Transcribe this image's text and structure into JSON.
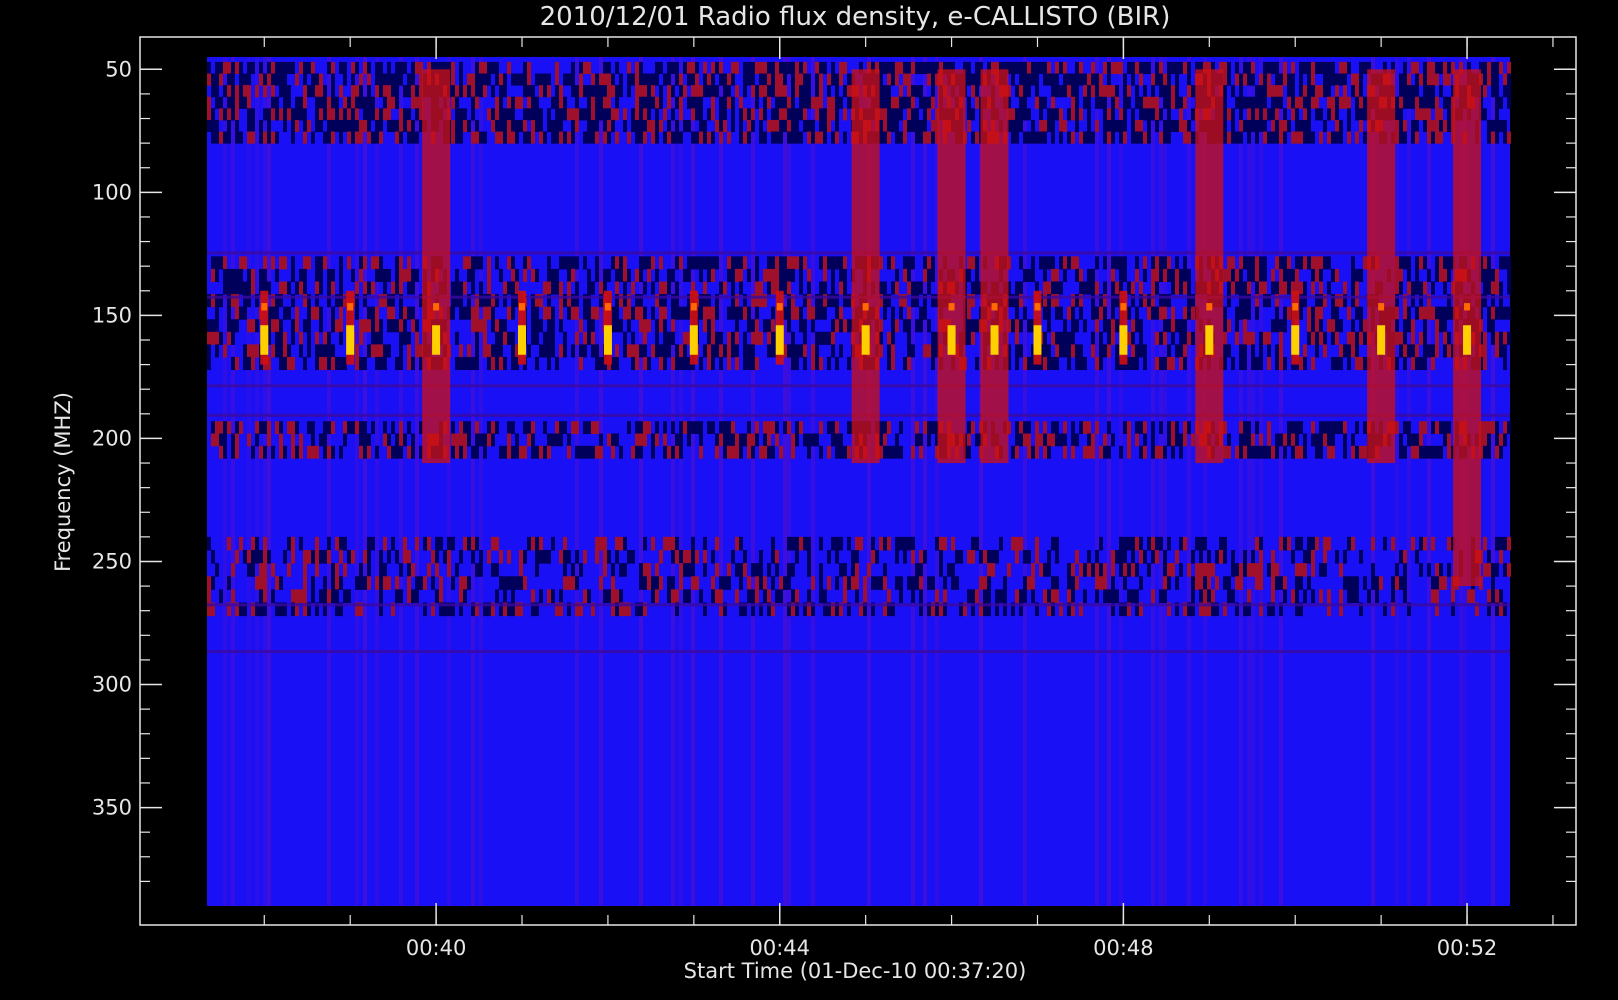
{
  "chart_data": {
    "type": "heatmap",
    "title": "2010/12/01  Radio flux density, e-CALLISTO (BIR)",
    "xlabel": "Start Time (01-Dec-10 00:37:20)",
    "ylabel": "Frequency (MHZ)",
    "y_axis_inverted": true,
    "ylim": [
      45,
      390
    ],
    "xlim": [
      "00:37:20",
      "00:52:30"
    ],
    "x_ticks": [
      "00:40",
      "00:44",
      "00:48",
      "00:52"
    ],
    "y_ticks": [
      50,
      100,
      150,
      200,
      250,
      300,
      350
    ],
    "colormap": [
      "#000000",
      "#0000ff",
      "#cc0000",
      "#ffff00"
    ],
    "background_color": "#000000",
    "bursts": [
      {
        "time": "00:38:00",
        "freq_range": [
          140,
          170
        ],
        "intensity": "high"
      },
      {
        "time": "00:39:00",
        "freq_range": [
          140,
          170
        ],
        "intensity": "high"
      },
      {
        "time": "00:40:00",
        "freq_range": [
          50,
          210
        ],
        "intensity": "high"
      },
      {
        "time": "00:41:00",
        "freq_range": [
          140,
          170
        ],
        "intensity": "high"
      },
      {
        "time": "00:42:00",
        "freq_range": [
          140,
          170
        ],
        "intensity": "high"
      },
      {
        "time": "00:43:00",
        "freq_range": [
          140,
          170
        ],
        "intensity": "high"
      },
      {
        "time": "00:44:00",
        "freq_range": [
          140,
          170
        ],
        "intensity": "high"
      },
      {
        "time": "00:45:00",
        "freq_range": [
          50,
          210
        ],
        "intensity": "high"
      },
      {
        "time": "00:46:00",
        "freq_range": [
          50,
          210
        ],
        "intensity": "high"
      },
      {
        "time": "00:46:30",
        "freq_range": [
          50,
          210
        ],
        "intensity": "high"
      },
      {
        "time": "00:47:00",
        "freq_range": [
          140,
          170
        ],
        "intensity": "high"
      },
      {
        "time": "00:48:00",
        "freq_range": [
          140,
          170
        ],
        "intensity": "high"
      },
      {
        "time": "00:49:00",
        "freq_range": [
          50,
          210
        ],
        "intensity": "high"
      },
      {
        "time": "00:50:00",
        "freq_range": [
          140,
          170
        ],
        "intensity": "high"
      },
      {
        "time": "00:51:00",
        "freq_range": [
          50,
          210
        ],
        "intensity": "high"
      },
      {
        "time": "00:52:00",
        "freq_range": [
          50,
          260
        ],
        "intensity": "high"
      }
    ]
  }
}
